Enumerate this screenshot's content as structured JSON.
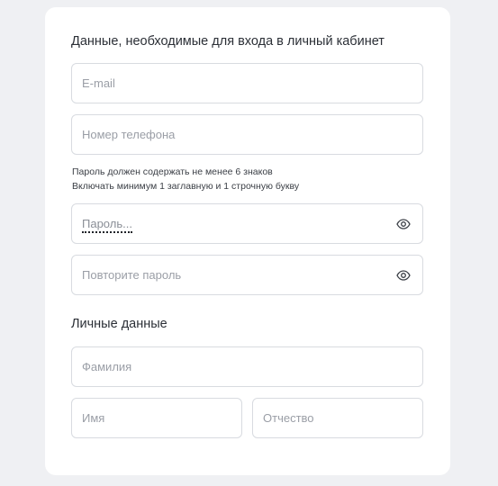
{
  "login_section": {
    "title": "Данные, необходимые для входа в личный кабинет",
    "email_placeholder": "E-mail",
    "phone_placeholder": "Номер телефона",
    "password_hint_line1": "Пароль должен содержать не менее 6 знаков",
    "password_hint_line2": "Включать минимум 1 заглавную и 1 строчную букву",
    "password_placeholder": "Пароль...",
    "repeat_password_placeholder": "Повторите пароль"
  },
  "personal_section": {
    "title": "Личные данные",
    "surname_placeholder": "Фамилия",
    "name_placeholder": "Имя",
    "patronymic_placeholder": "Отчество"
  },
  "icons": {
    "eye": "eye-icon"
  },
  "colors": {
    "page_background": "#eff0f3",
    "card_background": "#ffffff",
    "field_border": "#d8dbe0",
    "placeholder_text": "#9a9ea6",
    "heading_text": "#2b2f36"
  }
}
